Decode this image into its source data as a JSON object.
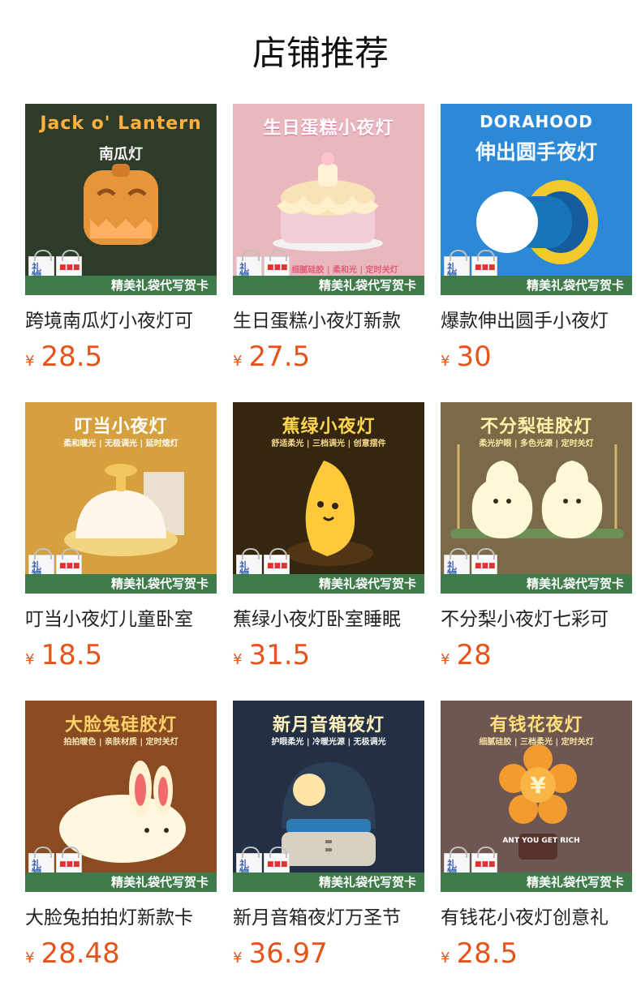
{
  "page": {
    "title": "店铺推荐"
  },
  "promo_banner": "精美礼袋代写贺卡",
  "currency_symbol": "¥",
  "products": [
    {
      "image": {
        "title": "Jack o' Lantern",
        "subtitle": "南瓜灯",
        "background": "#2f3b2a",
        "accent": "#efad58",
        "icon": "pumpkin-lamp-icon"
      },
      "name": "跨境南瓜灯小夜灯可",
      "price": "28.5"
    },
    {
      "image": {
        "title": "生日蛋糕小夜灯",
        "subtitle": "细腻硅胶 | 柔和光 | 定时关灯",
        "background": "#e9b8be",
        "accent": "#f4d8a0",
        "icon": "birthday-cake-lamp-icon"
      },
      "name": "生日蛋糕小夜灯新款",
      "price": "27.5"
    },
    {
      "image": {
        "title": "DORAHOOD",
        "subtitle": "伸出圆手夜灯",
        "background": "#2c89d7",
        "accent": "#f1c72f",
        "icon": "round-hand-lamp-icon"
      },
      "name": "爆款伸出圆手小夜灯",
      "price": "30"
    },
    {
      "image": {
        "title": "叮当小夜灯",
        "subtitle": "柔和暖光 | 无极调光 | 延时熄灯",
        "background": "#d7a03e",
        "accent": "#f0d28c",
        "icon": "bell-lamp-icon"
      },
      "name": "叮当小夜灯儿童卧室",
      "price": "18.5"
    },
    {
      "image": {
        "title": "蕉绿小夜灯",
        "subtitle": "舒适柔光 | 三档调光 | 创意摆件",
        "background": "#352610",
        "accent": "#f6c338",
        "icon": "banana-lamp-icon"
      },
      "name": "蕉绿小夜灯卧室睡眠",
      "price": "31.5"
    },
    {
      "image": {
        "title": "不分梨硅胶灯",
        "subtitle": "柔光护眼 | 多色光源 | 定时关灯",
        "background": "#7b6a47",
        "accent": "#f5e68f",
        "icon": "pear-lamp-icon"
      },
      "name": "不分梨小夜灯七彩可",
      "price": "28"
    },
    {
      "image": {
        "title": "大脸兔硅胶灯",
        "subtitle": "拍拍暖色 | 亲肤材质 | 定时关灯",
        "background": "#8a4b22",
        "accent": "#f7d39a",
        "icon": "rabbit-lamp-icon"
      },
      "name": "大脸兔拍拍灯新款卡",
      "price": "28.48"
    },
    {
      "image": {
        "title": "新月音箱夜灯",
        "subtitle": "护眼柔光 | 冷暖光源 | 无极调光",
        "background": "#233044",
        "accent": "#f5c76c",
        "icon": "moon-speaker-lamp-icon"
      },
      "name": "新月音箱夜灯万圣节",
      "price": "36.97"
    },
    {
      "image": {
        "title": "有钱花夜灯",
        "subtitle": "细腻硅胶 | 三档柔光 | 定时关灯",
        "background": "#6e5752",
        "accent": "#f19d43",
        "icon": "money-flower-lamp-icon",
        "product_text": "ANT YOU GET RICH"
      },
      "name": "有钱花小夜灯创意礼",
      "price": "28.5"
    }
  ]
}
